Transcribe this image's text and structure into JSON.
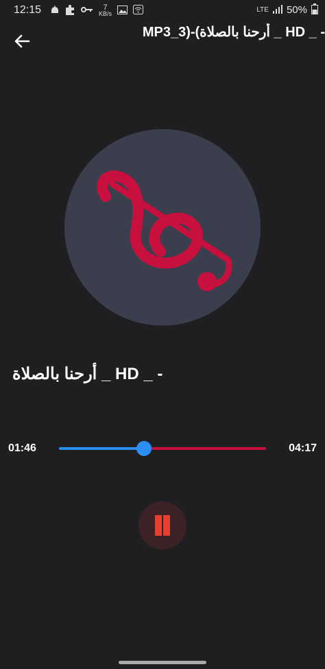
{
  "status_bar": {
    "time": "12:15",
    "net_speed_value": "7",
    "net_speed_unit": "KB/s",
    "network_type": "LTE",
    "battery": "50%"
  },
  "app_bar": {
    "title": "- _ HD _ أرحنا بالصلاة)-(MP3_3"
  },
  "player": {
    "song_title": "- _ HD _ أرحنا بالصلاة",
    "current_time": "01:46",
    "total_time": "04:17",
    "progress_fraction": 0.412,
    "state": "playing"
  },
  "colors": {
    "background": "#1f1f21",
    "album_circle": "#3a3e4d",
    "clef": "#c8103e",
    "seek_played": "#2a8ef2",
    "seek_remaining": "#c8103e",
    "pause_icon": "#e8402e"
  },
  "icons": {
    "back": "arrow-left-icon",
    "album": "treble-clef-icon",
    "control": "pause-icon"
  }
}
